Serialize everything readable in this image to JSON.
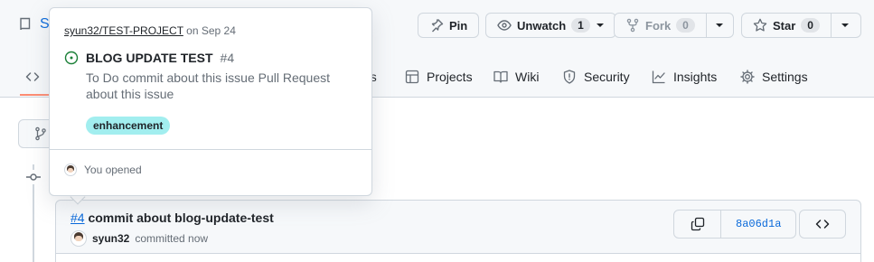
{
  "repo": {
    "name_fragment": "S"
  },
  "actions": {
    "pin": "Pin",
    "unwatch": "Unwatch",
    "unwatch_count": "1",
    "fork": "Fork",
    "fork_count": "0",
    "star": "Star",
    "star_count": "0"
  },
  "tabs": {
    "code_fragment": "",
    "actions_fragment": "ns",
    "projects": "Projects",
    "wiki": "Wiki",
    "security": "Security",
    "insights": "Insights",
    "settings": "Settings"
  },
  "popover": {
    "repo": "syun32/TEST-PROJECT",
    "date": "on Sep 24",
    "title": "BLOG UPDATE TEST",
    "number": "#4",
    "body": "To Do commit about this issue Pull Request about this issue",
    "label": "enhancement",
    "footer": "You opened"
  },
  "commit": {
    "issue_ref": "#4",
    "message": "commit about blog-update-test",
    "author": "syun32",
    "time": "committed now",
    "sha": "8a06d1a"
  },
  "colors": {
    "accent": "#0969da",
    "label_bg": "#a2eeef",
    "tab_underline": "#fd8c73",
    "open_green": "#1a7f37"
  }
}
